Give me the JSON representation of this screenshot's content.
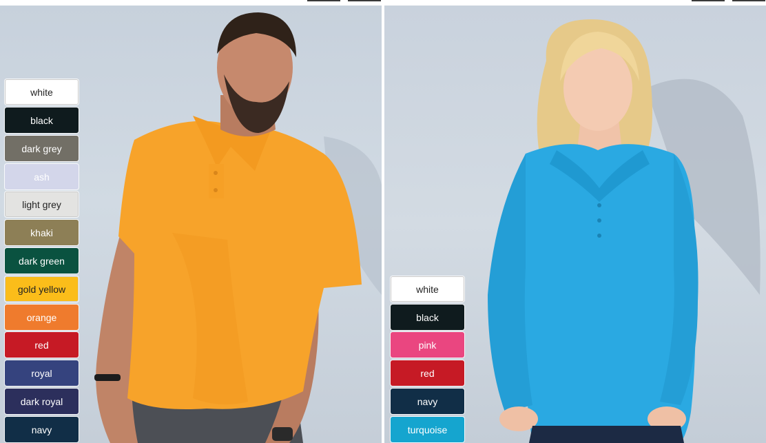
{
  "men_panel": {
    "swatches": [
      {
        "label": "white",
        "color": "#ffffff",
        "light": true
      },
      {
        "label": "black",
        "color": "#0f1b1e",
        "light": false
      },
      {
        "label": "dark grey",
        "color": "#726f66",
        "light": false
      },
      {
        "label": "ash",
        "color": "#d3d6ea",
        "light": false
      },
      {
        "label": "light grey",
        "color": "#e3e3e1",
        "light": true
      },
      {
        "label": "khaki",
        "color": "#8d7f56",
        "light": false
      },
      {
        "label": "dark green",
        "color": "#0a5240",
        "light": false
      },
      {
        "label": "gold yellow",
        "color": "#fbbd1a",
        "light": true
      },
      {
        "label": "orange",
        "color": "#ef7b2d",
        "light": false
      },
      {
        "label": "red",
        "color": "#c61a25",
        "light": false
      },
      {
        "label": "royal",
        "color": "#35437e",
        "light": false
      },
      {
        "label": "dark royal",
        "color": "#2c2f5c",
        "light": false
      },
      {
        "label": "navy",
        "color": "#112e47",
        "light": false
      }
    ]
  },
  "women_panel": {
    "swatches": [
      {
        "label": "white",
        "color": "#ffffff",
        "light": true
      },
      {
        "label": "black",
        "color": "#0f1b1e",
        "light": false
      },
      {
        "label": "pink",
        "color": "#ea4680",
        "light": false
      },
      {
        "label": "red",
        "color": "#c61a25",
        "light": false
      },
      {
        "label": "navy",
        "color": "#112e47",
        "light": false
      },
      {
        "label": "turquoise",
        "color": "#15a5cf",
        "light": false
      }
    ]
  }
}
